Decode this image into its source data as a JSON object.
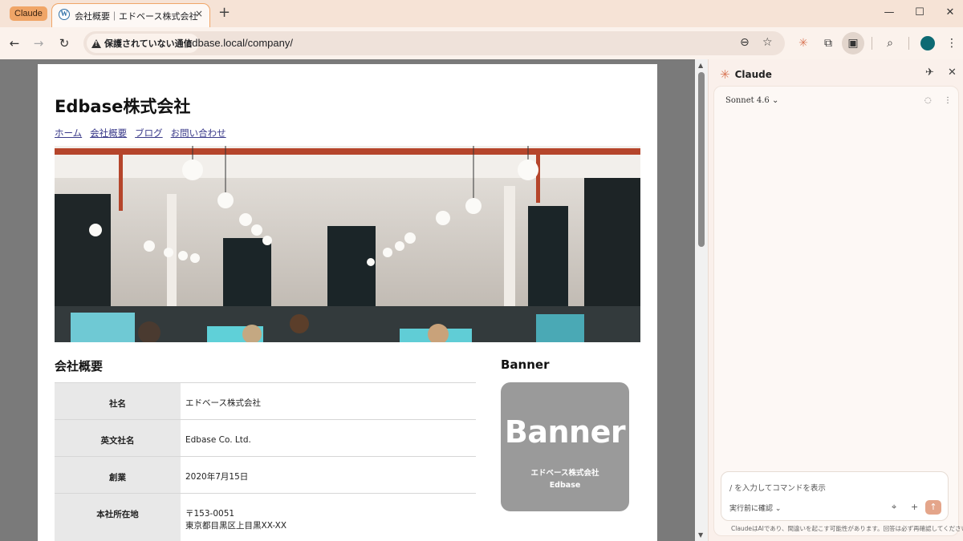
{
  "browser": {
    "tab_group": "Claude",
    "tab_title": "会社概要｜エドベース株式会社",
    "tab_close": "×",
    "new_tab": "+",
    "security_text": "保護されていない通信",
    "url": "edbase.local/company/"
  },
  "site": {
    "title": "Edbase株式会社",
    "nav": [
      "ホーム",
      "会社概要",
      "ブログ",
      "お問い合わせ"
    ],
    "section_title": "会社概要",
    "table": [
      {
        "label": "社名",
        "value": "エドベース株式会社"
      },
      {
        "label": "英文社名",
        "value": "Edbase Co. Ltd."
      },
      {
        "label": "創業",
        "value": "2020年7月15日"
      },
      {
        "label": "本社所在地",
        "value": "〒153-0051",
        "value2": "東京都目黒区上目黒XX-XX"
      }
    ],
    "banner_heading": "Banner",
    "banner": {
      "big": "Banner",
      "line1": "エドベース株式会社",
      "line2": "Edbase"
    }
  },
  "panel": {
    "title": "Claude",
    "model": "Sonnet 4.6 ⌄",
    "placeholder": "/ を入力してコマンドを表示",
    "mode": "実行前に確認 ⌄",
    "disclaimer": "ClaudeはAIであり、間違いを起こす可能性があります。回答は必ず再確認してください。"
  },
  "colors": {
    "accent": "#f0a567",
    "claude": "#d97757",
    "banner_bg": "#9a9a9a"
  }
}
